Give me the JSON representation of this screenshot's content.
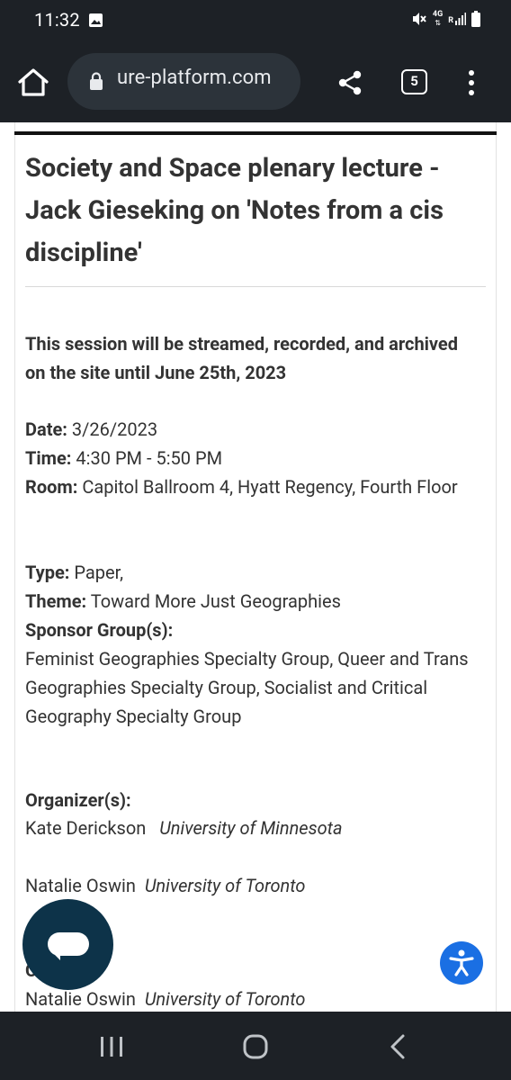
{
  "status_bar": {
    "time": "11:32",
    "network": "4G",
    "sim": "R"
  },
  "browser": {
    "url": "ure-platform.com",
    "tab_count": "5"
  },
  "session": {
    "title": "Society and Space plenary lecture - Jack Gieseking on 'Notes from a cis discipline'",
    "stream_note": "This session will be streamed, recorded, and archived on the site until June 25th, 2023",
    "date_label": "Date:",
    "date_value": " 3/26/2023",
    "time_label": "Time:",
    "time_value": " 4:30 PM - 5:50 PM",
    "room_label": "Room:",
    "room_value": " Capitol Ballroom 4, Hyatt Regency, Fourth Floor",
    "type_label": "Type:",
    "type_value": " Paper,",
    "theme_label": "Theme:",
    "theme_value": " Toward More Just Geographies",
    "sponsor_label": "Sponsor Group(s):",
    "sponsor_value": "Feminist Geographies Specialty Group, Queer and Trans Geographies Specialty Group, Socialist and Critical Geography Specialty Group",
    "organizers_label": "Organizer(s):",
    "organizers": [
      {
        "name": "Kate Derickson",
        "affiliation": "University of Minnesota"
      },
      {
        "name": "Natalie Oswin",
        "affiliation": "University of Toronto"
      }
    ],
    "chairs_partial_label": "C",
    "chairs": [
      {
        "name": "Natalie Oswin",
        "affiliation": "University of Toronto"
      }
    ]
  },
  "icons": {
    "home": "home-icon",
    "lock": "lock-icon",
    "share": "share-icon",
    "menu": "more-vert-icon",
    "chat": "chat-icon",
    "accessibility": "accessibility-icon"
  },
  "colors": {
    "system_bar": "#1d2126",
    "url_pill": "#2c333a",
    "chat_fab": "#0d3349",
    "accessibility_fab": "#1a6fe3",
    "text": "#333333"
  }
}
